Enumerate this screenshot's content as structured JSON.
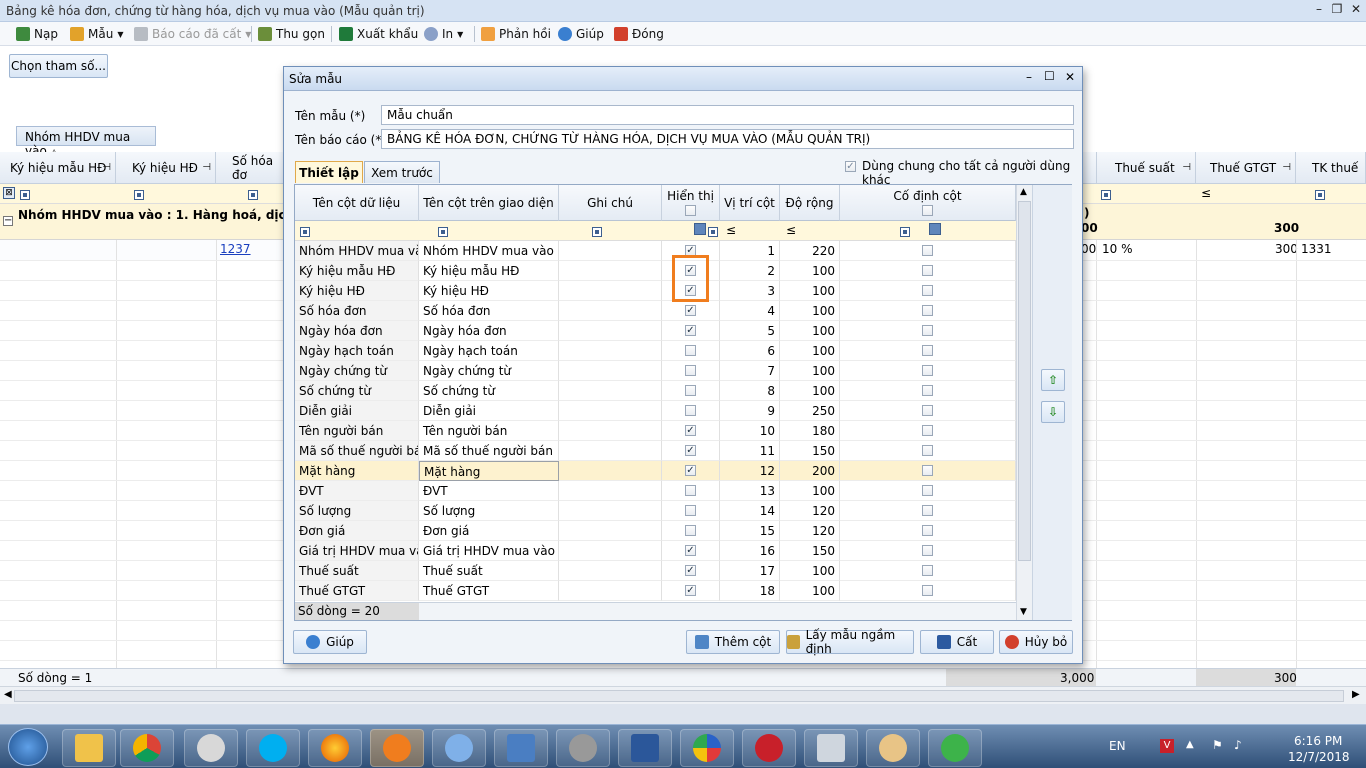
{
  "window": {
    "title": "Bảng kê hóa đơn, chứng từ hàng hóa, dịch vụ mua vào (Mẫu quản trị)"
  },
  "toolbar": {
    "nap": "Nạp",
    "mau": "Mẫu",
    "bao_cao_da_cat": "Báo cáo đã cất",
    "thu_gon": "Thu gọn",
    "xuat_khau": "Xuất khẩu",
    "in": "In",
    "phan_hoi": "Phản hồi",
    "giup": "Giúp",
    "dong": "Đóng"
  },
  "choose_params": "Chọn tham số...",
  "group_panel": "Nhóm HHDV mua vào",
  "bg_grid": {
    "headers": [
      "Ký hiệu mẫu HĐ",
      "Ký hiệu HĐ",
      "Số hóa đơ",
      "Thuế suất",
      "Thuế GTGT",
      "TK thuế"
    ],
    "group_row": "Nhóm HHDV mua vào : 1. Hàng hoá, dịch vụ dùng",
    "group_tail_a": "00",
    "group_tail_b": "300",
    "group_tail_c": ")",
    "row": {
      "so_hoa_don": "1237",
      "total": "00",
      "thue_suat": "10 %",
      "thue_gtgt": "300",
      "tk_thue": "1331"
    },
    "footer": {
      "so_dong": "Số dòng = 1",
      "sum1": "3,000",
      "sum2": "300"
    },
    "filter_le": "≤"
  },
  "dialog": {
    "title": "Sửa mẫu",
    "ten_mau_label": "Tên mẫu (*)",
    "ten_mau_value": "Mẫu chuẩn",
    "ten_bao_cao_label": "Tên báo cáo (*)",
    "ten_bao_cao_value": "BẢNG KÊ HÓA ĐƠN, CHỨNG TỪ HÀNG HÓA, DỊCH VỤ MUA VÀO (MẪU QUẢN TRỊ)",
    "tab_thiet_lap": "Thiết lập",
    "tab_xem_truoc": "Xem trước",
    "dung_chung": "Dùng chung cho tất cả người dùng khác",
    "columns": [
      "Tên cột dữ liệu",
      "Tên cột trên giao diện",
      "Ghi chú",
      "Hiển thị",
      "Vị trí cột",
      "Độ rộng",
      "Cố định cột"
    ],
    "rows": [
      {
        "name": "Nhóm HHDV mua vào",
        "ui": "Nhóm HHDV mua vào",
        "show": true,
        "pos": "1",
        "width": "220"
      },
      {
        "name": "Ký hiệu mẫu HĐ",
        "ui": "Ký hiệu mẫu HĐ",
        "show": true,
        "pos": "2",
        "width": "100"
      },
      {
        "name": "Ký hiệu HĐ",
        "ui": "Ký hiệu HĐ",
        "show": true,
        "pos": "3",
        "width": "100"
      },
      {
        "name": "Số hóa đơn",
        "ui": "Số hóa đơn",
        "show": true,
        "pos": "4",
        "width": "100"
      },
      {
        "name": "Ngày hóa đơn",
        "ui": "Ngày hóa đơn",
        "show": true,
        "pos": "5",
        "width": "100"
      },
      {
        "name": "Ngày hạch toán",
        "ui": "Ngày hạch toán",
        "show": false,
        "pos": "6",
        "width": "100"
      },
      {
        "name": "Ngày chứng từ",
        "ui": "Ngày chứng từ",
        "show": false,
        "pos": "7",
        "width": "100"
      },
      {
        "name": "Số chứng từ",
        "ui": "Số chứng từ",
        "show": false,
        "pos": "8",
        "width": "100"
      },
      {
        "name": "Diễn giải",
        "ui": "Diễn giải",
        "show": false,
        "pos": "9",
        "width": "250"
      },
      {
        "name": "Tên người bán",
        "ui": "Tên người bán",
        "show": true,
        "pos": "10",
        "width": "180"
      },
      {
        "name": "Mã số thuế người bán",
        "ui": "Mã số thuế người bán",
        "show": true,
        "pos": "11",
        "width": "150"
      },
      {
        "name": "Mặt hàng",
        "ui": "Mặt hàng",
        "show": true,
        "pos": "12",
        "width": "200"
      },
      {
        "name": "ĐVT",
        "ui": "ĐVT",
        "show": false,
        "pos": "13",
        "width": "100"
      },
      {
        "name": "Số lượng",
        "ui": "Số lượng",
        "show": false,
        "pos": "14",
        "width": "120"
      },
      {
        "name": "Đơn giá",
        "ui": "Đơn giá",
        "show": false,
        "pos": "15",
        "width": "120"
      },
      {
        "name": "Giá trị HHDV mua và...",
        "ui": "Giá trị HHDV mua vào ch...",
        "show": true,
        "pos": "16",
        "width": "150"
      },
      {
        "name": "Thuế suất",
        "ui": "Thuế suất",
        "show": true,
        "pos": "17",
        "width": "100"
      },
      {
        "name": "Thuế GTGT",
        "ui": "Thuế GTGT",
        "show": true,
        "pos": "18",
        "width": "100"
      }
    ],
    "so_dong": "Số dòng = 20",
    "buttons": {
      "giup": "Giúp",
      "them_cot": "Thêm cột",
      "lay_mau": "Lấy mẫu ngầm định",
      "cat": "Cất",
      "huy_bo": "Hủy bỏ"
    }
  },
  "taskbar": {
    "lang": "EN",
    "time": "6:16 PM",
    "date": "12/7/2018"
  },
  "colors": {
    "highlight": "#f07d1e",
    "selected_row": "#fdf2cf",
    "accent": "#3d5f8f"
  }
}
